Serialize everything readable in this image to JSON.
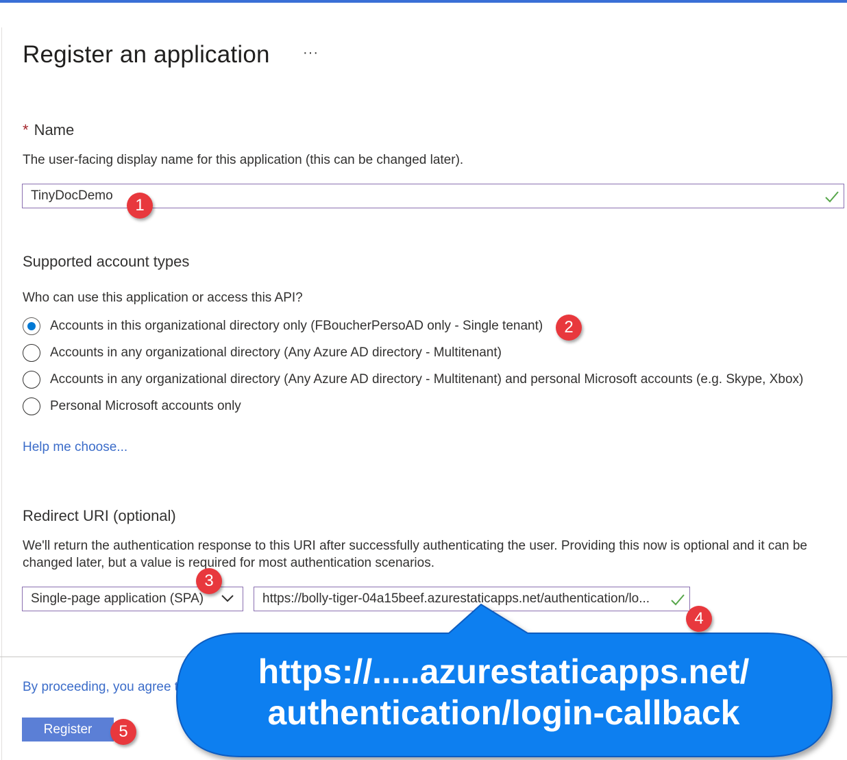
{
  "page": {
    "title": "Register an application",
    "more_label": "···"
  },
  "name_section": {
    "label": "Name",
    "required_marker": "*",
    "description": "The user-facing display name for this application (this can be changed later).",
    "value": "TinyDocDemo"
  },
  "account_types": {
    "label": "Supported account types",
    "question": "Who can use this application or access this API?",
    "options": [
      {
        "label": "Accounts in this organizational directory only (FBoucherPersoAD only - Single tenant)",
        "selected": true
      },
      {
        "label": "Accounts in any organizational directory (Any Azure AD directory - Multitenant)",
        "selected": false
      },
      {
        "label": "Accounts in any organizational directory (Any Azure AD directory - Multitenant) and personal Microsoft accounts (e.g. Skype, Xbox)",
        "selected": false
      },
      {
        "label": "Personal Microsoft accounts only",
        "selected": false
      }
    ],
    "help_link": "Help me choose..."
  },
  "redirect": {
    "label": "Redirect URI (optional)",
    "description_line1": "We'll return the authentication response to this URI after successfully authenticating the user. Providing this now is optional and it can be",
    "description_line2": "changed later, but a value is required for most authentication scenarios.",
    "platform": "Single-page application (SPA)",
    "uri": "https://bolly-tiger-04a15beef.azurestaticapps.net/authentication/lo..."
  },
  "footer": {
    "agree_text": "By proceeding, you agree t",
    "register_label": "Register"
  },
  "annotations": {
    "badges": [
      "1",
      "2",
      "3",
      "4",
      "5"
    ],
    "callout_line1": "https://.....azurestaticapps.net/",
    "callout_line2": "authentication/login-callback"
  },
  "colors": {
    "accent": "#0078d4",
    "link": "#3b6cc9",
    "valid_check": "#57a64a",
    "badge": "#e8383d",
    "callout": "#0b7ff0"
  }
}
